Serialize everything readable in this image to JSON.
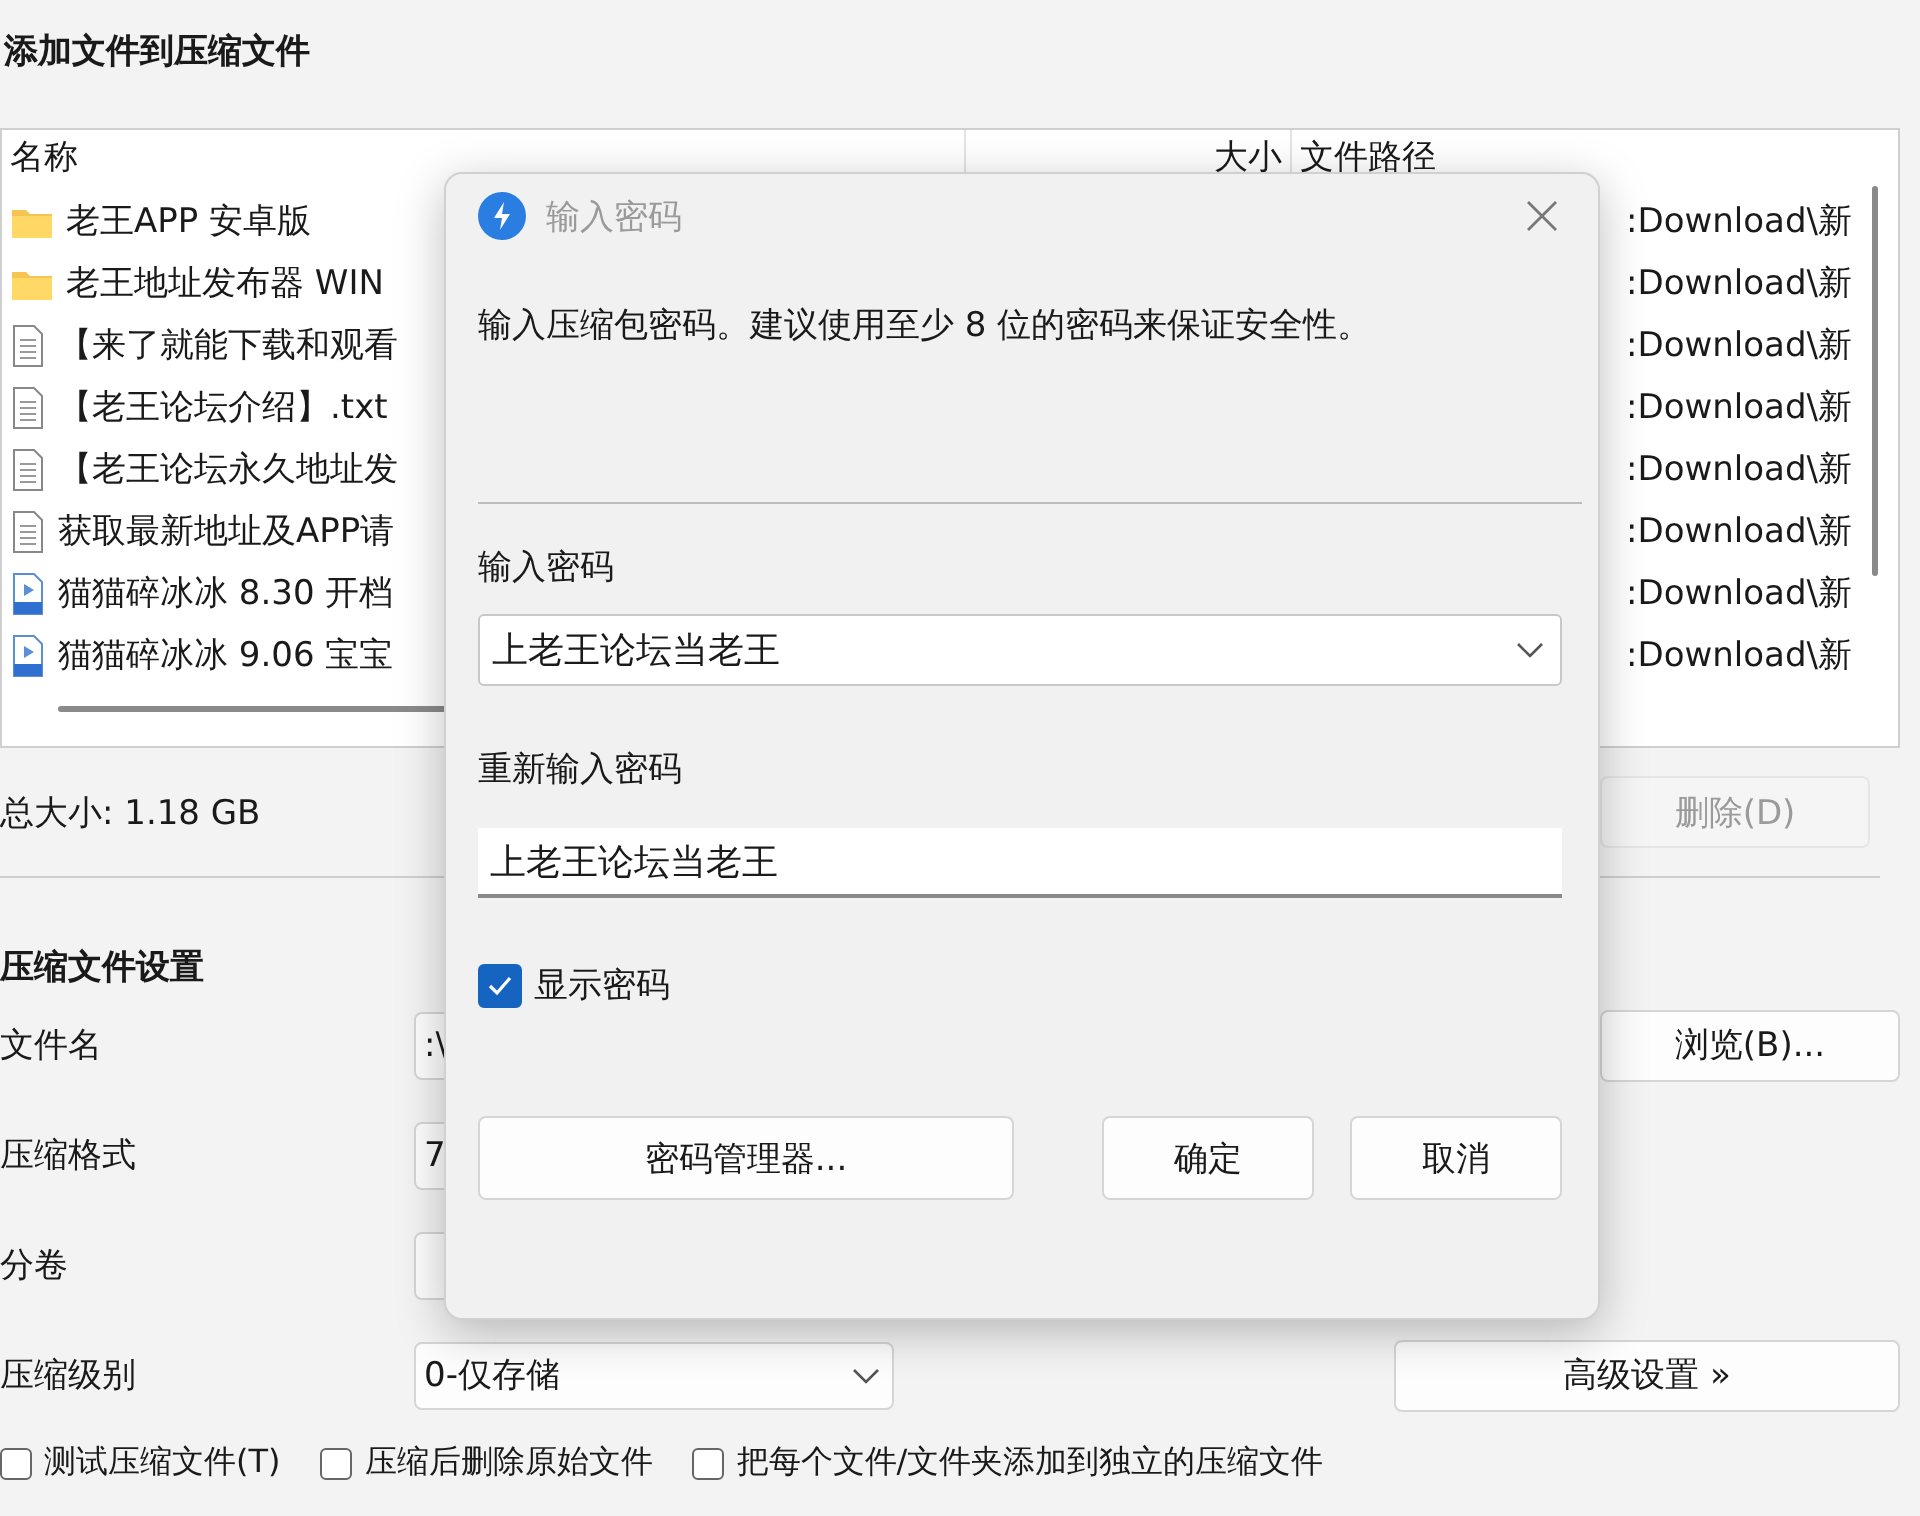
{
  "main_window": {
    "title": "添加文件到压缩文件",
    "file_list": {
      "columns": [
        {
          "label": "名称"
        },
        {
          "label": "大小"
        },
        {
          "label": "文件路径"
        }
      ],
      "rows": [
        {
          "kind": "folder",
          "name": "老王APP 安卓版",
          "path": ":Download\\新"
        },
        {
          "kind": "folder",
          "name": "老王地址发布器 WIN",
          "path": ":Download\\新"
        },
        {
          "kind": "text",
          "name": "【来了就能下载和观看",
          "path": ":Download\\新"
        },
        {
          "kind": "text",
          "name": "【老王论坛介绍】.txt",
          "path": ":Download\\新"
        },
        {
          "kind": "text",
          "name": "【老王论坛永久地址发",
          "path": ":Download\\新"
        },
        {
          "kind": "text",
          "name": "获取最新地址及APP请",
          "path": ":Download\\新"
        },
        {
          "kind": "video",
          "name": "猫猫碎冰冰 8.30 开档",
          "path": ":Download\\新"
        },
        {
          "kind": "video",
          "name": "猫猫碎冰冰 9.06 宝宝",
          "path": ":Download\\新"
        }
      ]
    },
    "total_size": "总大小: 1.18 GB",
    "delete_button": {
      "label": "删除(D)",
      "disabled": true
    },
    "settings": {
      "heading": "压缩文件设置",
      "fields": [
        {
          "label": "文件名",
          "value": ":\\",
          "kind": "text",
          "button": "浏览(B)..."
        },
        {
          "label": "压缩格式",
          "value": "7",
          "kind": "text"
        },
        {
          "label": "分卷",
          "kind": "text"
        },
        {
          "label": "压缩级别",
          "value": "0-仅存储",
          "kind": "combo",
          "button": "高级设置 »"
        }
      ],
      "options": [
        {
          "label": "测试压缩文件(T)",
          "checked": false
        },
        {
          "label": "压缩后删除原始文件",
          "checked": false
        },
        {
          "label": "把每个文件/文件夹添加到独立的压缩文件",
          "checked": false
        }
      ]
    }
  },
  "dialog": {
    "title": "输入密码",
    "message": "输入压缩包密码。建议使用至少 8 位的密码来保证安全性。",
    "password_label": "输入密码",
    "password_value": "上老王论坛当老王",
    "confirm_label": "重新输入密码",
    "confirm_value": "上老王论坛当老王",
    "show_password": {
      "label": "显示密码",
      "checked": true
    },
    "buttons": [
      {
        "label": "密码管理器...",
        "kind": "wide"
      },
      {
        "label": "确定",
        "kind": "normal"
      },
      {
        "label": "取消",
        "kind": "normal"
      }
    ]
  }
}
